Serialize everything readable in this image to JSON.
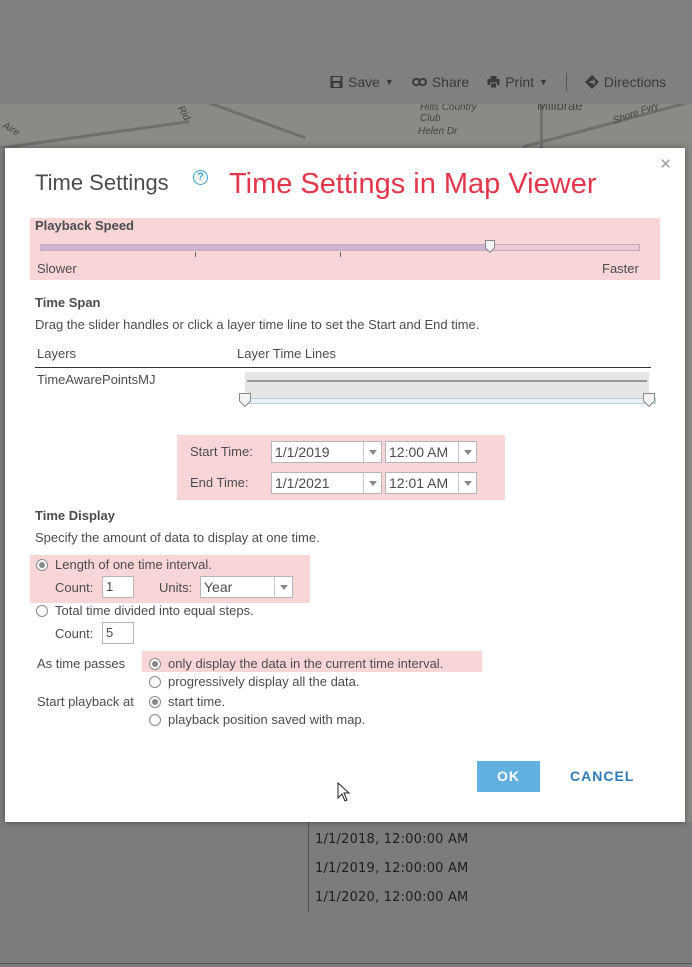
{
  "toolbar": {
    "save": "Save",
    "share": "Share",
    "print": "Print",
    "directions": "Directions"
  },
  "map_labels": [
    "Hills Country Club",
    "Helen Dr",
    "Millbrae",
    "Shore Fwy",
    "Rid",
    "Aire"
  ],
  "table_rows": [
    "1/1/2018, 12:00:00 AM",
    "1/1/2019, 12:00:00 AM",
    "1/1/2020, 12:00:00 AM"
  ],
  "dialog": {
    "title": "Time Settings",
    "help_icon": "?",
    "annotation": "Time Settings in Map Viewer",
    "close_icon": "×",
    "playback": {
      "label": "Playback Speed",
      "slower": "Slower",
      "faster": "Faster",
      "speed_fraction": 0.75
    },
    "time_span": {
      "label": "Time Span",
      "instructions": "Drag the slider handles or click a layer time line to set the Start and End time.",
      "col_layers": "Layers",
      "col_timelines": "Layer Time Lines",
      "layer_name": "TimeAwarePointsMJ",
      "start_label": "Start Time:",
      "start_date": "1/1/2019",
      "start_time": "12:00 AM",
      "end_label": "End Time:",
      "end_date": "1/1/2021",
      "end_time": "12:01 AM"
    },
    "time_display": {
      "label": "Time Display",
      "description": "Specify the amount of data to display at one time.",
      "opt_interval": "Length of one time interval.",
      "count_label": "Count:",
      "interval_count": "1",
      "units_label": "Units:",
      "units_value": "Year",
      "opt_steps": "Total time divided into equal steps.",
      "steps_count_label": "Count:",
      "steps_count": "5",
      "as_time_passes": "As time passes",
      "opt_current": "only display the data in the current time interval.",
      "opt_progressive": "progressively display all the data.",
      "start_playback": "Start playback at",
      "opt_start": "start time.",
      "opt_saved": "playback position saved with map."
    },
    "ok": "OK",
    "cancel": "CANCEL"
  },
  "colors": {
    "highlight": "#f8d6d8",
    "annotation": "#e3364a",
    "ok_button": "#62b0e0",
    "cancel_text": "#2f7ab8"
  }
}
